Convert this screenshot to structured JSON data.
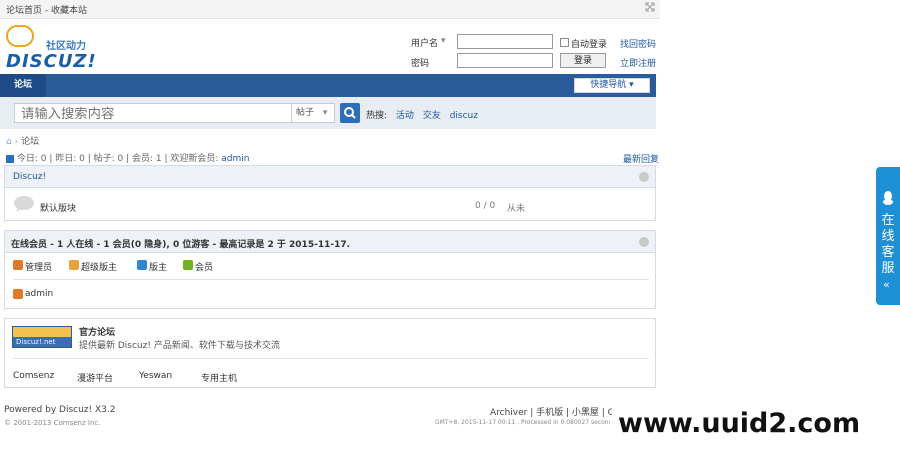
{
  "window": {
    "title": "论坛首页 - 收藏本站"
  },
  "logo": {
    "tagline": "社区动力",
    "brand": "DISCUZ!"
  },
  "login": {
    "username_label": "用户名",
    "password_label": "密码",
    "auto_login": "自动登录",
    "login_button": "登录",
    "forgot": "找回密码",
    "register": "立即注册"
  },
  "nav": {
    "active": "论坛",
    "quick_nav": "快捷导航"
  },
  "search": {
    "placeholder": "请输入搜索内容",
    "scope": "帖子",
    "hot_label": "热搜:",
    "hot_items": [
      "活动",
      "交友",
      "discuz"
    ]
  },
  "breadcrumb": {
    "current": "论坛"
  },
  "stats": {
    "text": "今日: 0 | 昨日: 0 | 帖子: 0 | 会员: 1 | 欢迎新会员:",
    "new_member": "admin",
    "latest": "最新回复"
  },
  "forum_group": {
    "title": "Discuz!",
    "forum_name": "默认版块",
    "count": "0 / 0",
    "last_post": "从未"
  },
  "online": {
    "title": "在线会员 - 1 人在线 - 1 会员(0 隐身), 0 位游客 - 最高记录是 2 于 2015-11-17.",
    "legend": [
      {
        "label": "管理员",
        "color": "#e07a28"
      },
      {
        "label": "超级版主",
        "color": "#e8a23b"
      },
      {
        "label": "版主",
        "color": "#2f86d1"
      },
      {
        "label": "会员",
        "color": "#6fb324"
      }
    ],
    "users": [
      "admin"
    ]
  },
  "links": {
    "banner_text": "Discuz!.net",
    "site_name": "官方论坛",
    "site_desc": "提供最新 Discuz! 产品新闻、软件下载与技术交流",
    "items": [
      "Comsenz",
      "漫游平台",
      "Yeswan",
      "专用主机"
    ]
  },
  "footer": {
    "powered": "Powered by Discuz! X3.2",
    "copyright": "© 2001-2013 Comsenz Inc.",
    "right_links": "Archiver | 手机版 | 小黑屋 | C",
    "gmt": "GMT+8, 2015-11-17 00:11 , Processed in 0.080027 second"
  },
  "promo": {
    "text": "www.uuid2.com"
  },
  "side_tab": {
    "text": "在线客服"
  }
}
